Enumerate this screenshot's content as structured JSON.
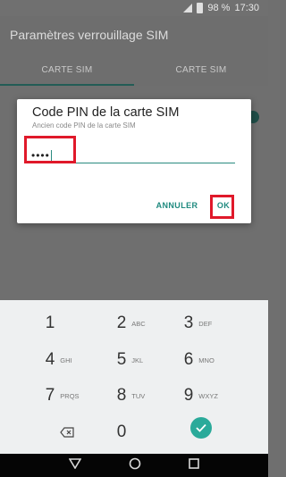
{
  "status": {
    "battery": "98 %",
    "time": "17:30",
    "network": "4G"
  },
  "app": {
    "title": "Paramètres verrouillage SIM"
  },
  "tabs": [
    {
      "label": "CARTE SIM"
    },
    {
      "label": "CARTE SIM"
    }
  ],
  "dialog": {
    "title": "Code PIN de la carte SIM",
    "subtitle": "Ancien code PIN de la carte SIM",
    "pin_masked": "••••",
    "cancel_label": "ANNULER",
    "ok_label": "OK"
  },
  "keypad": {
    "keys": [
      {
        "num": "1",
        "letters": ""
      },
      {
        "num": "2",
        "letters": "ABC"
      },
      {
        "num": "3",
        "letters": "DEF"
      },
      {
        "num": "4",
        "letters": "GHI"
      },
      {
        "num": "5",
        "letters": "JKL"
      },
      {
        "num": "6",
        "letters": "MNO"
      },
      {
        "num": "7",
        "letters": "PRQS"
      },
      {
        "num": "8",
        "letters": "TUV"
      },
      {
        "num": "9",
        "letters": "WXYZ"
      },
      {
        "num": "0",
        "letters": ""
      }
    ]
  },
  "colors": {
    "accent": "#1f8a7f",
    "highlight": "#e0192a",
    "done": "#2aaa9a"
  }
}
